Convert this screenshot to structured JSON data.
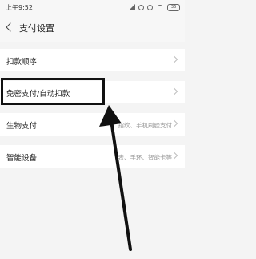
{
  "status_bar": {
    "time": "上午9:52",
    "battery": "36"
  },
  "header": {
    "title": "支付设置"
  },
  "items": [
    {
      "label": "扣款顺序",
      "sub": ""
    },
    {
      "label": "免密支付/自动扣款",
      "sub": ""
    },
    {
      "label": "生物支付",
      "sub": "指纹、手机刷脸支付"
    },
    {
      "label": "智能设备",
      "sub": "表、手环、智能卡等"
    }
  ],
  "annotation": {
    "stroke_color": "#111111"
  }
}
